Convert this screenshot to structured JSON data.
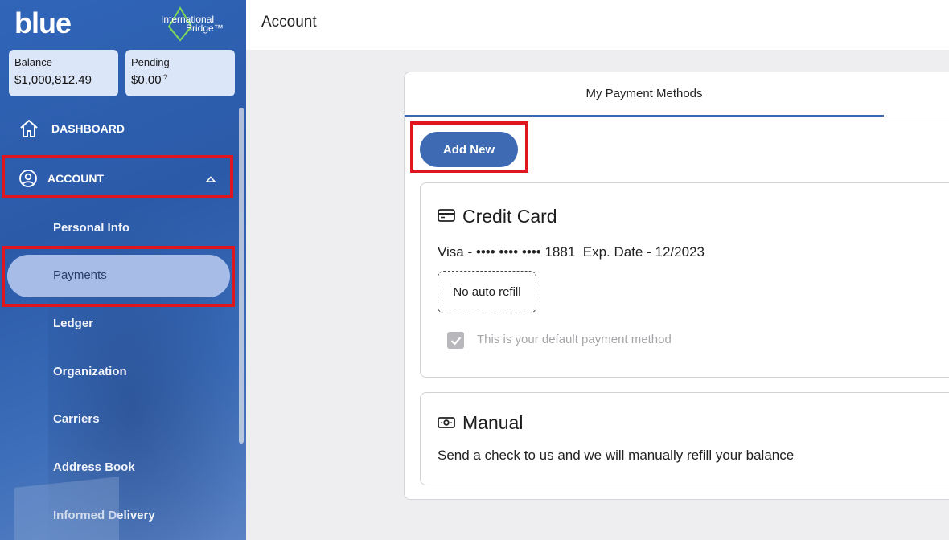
{
  "brand": {
    "logo_text": "blue",
    "partner_line1": "International",
    "partner_line2": "Bridge™"
  },
  "stats": {
    "balance_label": "Balance",
    "balance_value": "$1,000,812.49",
    "pending_label": "Pending",
    "pending_value": "$0.00",
    "pending_help": "?"
  },
  "nav": {
    "dashboard": {
      "label": "DASHBOARD",
      "icon": "home-icon"
    },
    "account": {
      "label": "ACCOUNT",
      "icon": "user-circle-icon",
      "expanded": true
    },
    "sub_items": [
      "Personal Info",
      "Payments",
      "Ledger",
      "Organization",
      "Carriers",
      "Address Book",
      "Informed Delivery"
    ],
    "active_item": "Payments"
  },
  "header": {
    "title": "Account"
  },
  "payments": {
    "tab_label": "My Payment Methods",
    "add_button": "Add New",
    "credit_card": {
      "title": "Credit Card",
      "icon": "credit-card-icon",
      "card_info": "Visa - •••• •••• •••• 1881",
      "exp": "Exp. Date - 12/2023",
      "refill": "No auto refill",
      "default_label": "This is your default payment method",
      "default_checked": true
    },
    "manual": {
      "title": "Manual",
      "icon": "cash-icon",
      "description": "Send a check to us and we will manually refill your balance"
    }
  },
  "colors": {
    "sidebar": "#2b5aa8",
    "accent": "#3d6ab2",
    "active_pill": "#a7bde8",
    "highlight": "#e0161f"
  }
}
